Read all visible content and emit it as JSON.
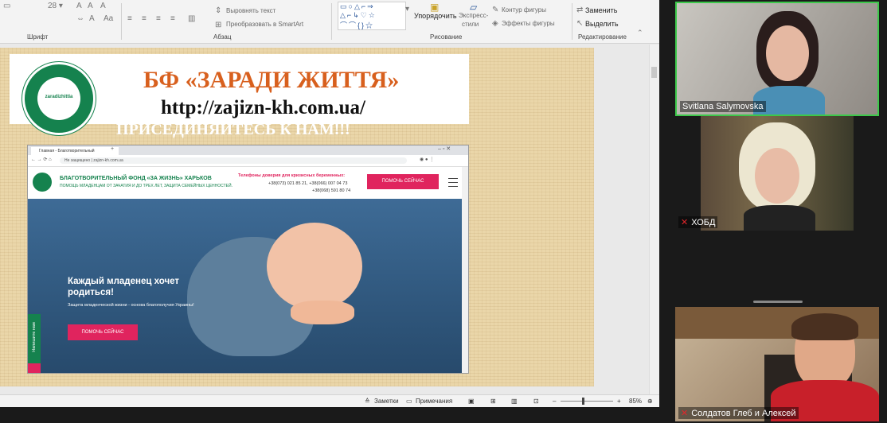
{
  "ribbon": {
    "groups": {
      "font": "Шрифт",
      "paragraph": "Абзац",
      "drawing": "Рисование",
      "editing": "Редактирование"
    },
    "align_text": "Выровнять текст",
    "smartart": "Преобразовать в SmartArt",
    "arrange": "Упорядочить",
    "quick_styles_1": "Экспресс-",
    "quick_styles_2": "стили",
    "shape_outline": "Контур фигуры",
    "shape_effects": "Эффекты фигуры",
    "replace": "Заменить",
    "select": "Выделить"
  },
  "slide": {
    "title": "БФ «ЗАРАДИ ЖИТТЯ»",
    "url": "http://zajizn-kh.com.ua/",
    "join": "ПРИСЕДИНЯЙТЕСЬ К НАМ!!!",
    "logo_text": "zaradizhittia"
  },
  "site": {
    "tab": "Главная - Благотворительный",
    "address": "Не защищено | zajizn-kh.com.ua",
    "name": "БЛАГОТВОРИТЕЛЬНЫЙ ФОНД «ЗА ЖИЗНЬ» ХАРЬКОВ",
    "subtitle": "ПОМОЩЬ МЛАДЕНЦАМ ОТ ЗАЧАТИЯ И ДО ТРЕХ ЛЕТ, ЗАЩИТА СЕМЕЙНЫХ ЦЕННОСТЕЙ.",
    "phones_title": "Телефоны доверия для кризисных беременных:",
    "phone_1": "+38(073) 021 85 21, +38(066) 007 04 73",
    "phone_2": "+38(068) 591 80 74",
    "help_button": "ПОМОЧЬ СЕЙЧАС",
    "hero_heading": "Каждый младенец хочет родиться!",
    "hero_sub": "Защита младенческой жизни - основа благополучия Украины!",
    "hero_button": "ПОМОЧЬ СЕЙЧАС",
    "side_tab": "Напишите нам"
  },
  "status": {
    "notes": "Заметки",
    "comments": "Примечания",
    "zoom": "85%"
  },
  "participants": [
    {
      "name": "Svitlana Salymovska"
    },
    {
      "name": "ХОБД"
    },
    {
      "name": "Солдатов Глеб и Алексей"
    }
  ]
}
